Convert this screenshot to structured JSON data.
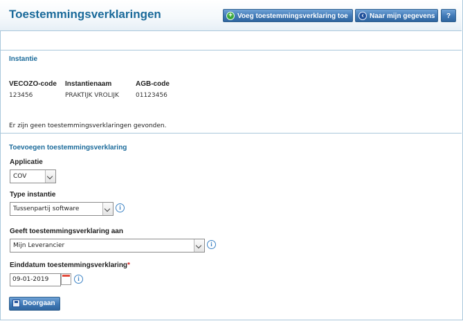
{
  "header": {
    "title": "Toestemmingsverklaringen",
    "add_button": "Voeg toestemmingsverklaring toe",
    "back_button": "Naar mijn gegevens",
    "help_button": "?"
  },
  "instantie": {
    "section_title": "Instantie",
    "columns": [
      {
        "label": "VECOZO-code",
        "value": "123456"
      },
      {
        "label": "Instantienaam",
        "value": "PRAKTIJK VROLIJK"
      },
      {
        "label": "AGB-code",
        "value": "01123456"
      }
    ],
    "empty_message": "Er zijn geen toestemmingsverklaringen gevonden."
  },
  "form": {
    "section_title": "Toevoegen toestemmingsverklaring",
    "applicatie": {
      "label": "Applicatie",
      "value": "COV"
    },
    "type_instantie": {
      "label": "Type instantie",
      "value": "Tussenpartij software"
    },
    "geeft_aan": {
      "label": "Geeft toestemmingsverklaring aan",
      "value": "Mijn Leverancier"
    },
    "einddatum": {
      "label": "Einddatum toestemmingsverklaring",
      "required_mark": "*",
      "value": "09-01-2019"
    },
    "submit": "Doorgaan"
  },
  "icons": {
    "add": "plus-circle-icon",
    "back": "arrow-left-circle-icon",
    "info": "info-icon",
    "calendar": "calendar-icon",
    "save": "save-disk-icon"
  }
}
